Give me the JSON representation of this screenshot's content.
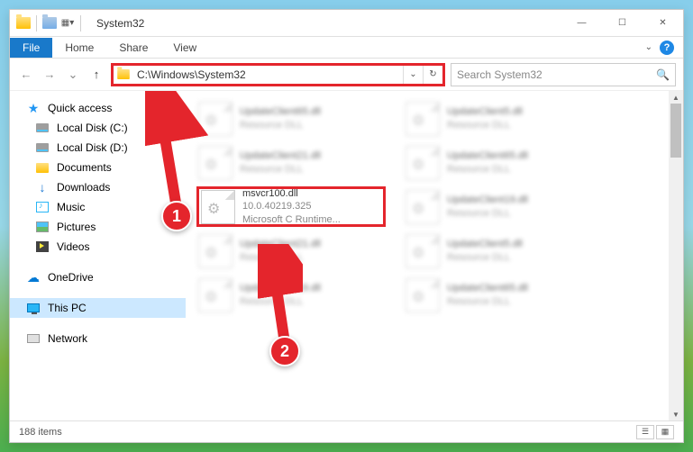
{
  "window": {
    "title": "System32",
    "controls": {
      "min": "—",
      "max": "☐",
      "close": "✕"
    }
  },
  "ribbon": {
    "file": "File",
    "home": "Home",
    "share": "Share",
    "view": "View"
  },
  "nav": {
    "back": "←",
    "forward": "→",
    "dropdown": "⌄",
    "up": "↑",
    "address": "C:\\Windows\\System32",
    "addr_dropdown": "⌄",
    "refresh": "↻"
  },
  "search": {
    "placeholder": "Search System32"
  },
  "sidebar": {
    "quick": "Quick access",
    "items": [
      "Local Disk (C:)",
      "Local Disk (D:)",
      "Documents",
      "Downloads",
      "Music",
      "Pictures",
      "Videos"
    ],
    "onedrive": "OneDrive",
    "thispc": "This PC",
    "network": "Network"
  },
  "files": {
    "blurred": [
      {
        "name": "UpdateClient65.dll",
        "meta": "Resource DLL"
      },
      {
        "name": "UpdateClient5.dll",
        "meta": "Resource DLL"
      },
      {
        "name": "UpdateClient21.dll",
        "meta": "Resource DLL"
      },
      {
        "name": "UpdateClient65.dll",
        "meta": "Resource DLL"
      },
      {
        "name": "UpdateClient19.dll",
        "meta": "Resource DLL"
      },
      {
        "name": "UpdateClient21.dll",
        "meta": "Resource DLL"
      },
      {
        "name": "UpdateClient5.dll",
        "meta": "Resource DLL"
      },
      {
        "name": "UpdateClient19.dll",
        "meta": "Resource DLL"
      },
      {
        "name": "UpdateClient65.dll",
        "meta": "Resource DLL"
      }
    ],
    "highlighted": {
      "name": "msvcr100.dll",
      "version": "10.0.40219.325",
      "desc": "Microsoft C Runtime..."
    }
  },
  "status": {
    "items": "188 items"
  },
  "callouts": {
    "one": "1",
    "two": "2"
  }
}
